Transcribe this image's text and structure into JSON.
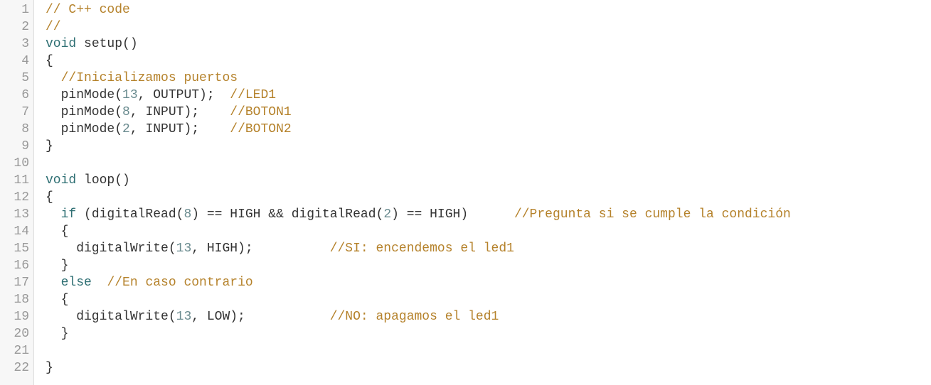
{
  "editor": {
    "colors": {
      "comment": "#b5822b",
      "keyword": "#2e6f73",
      "number": "#6a8b8f",
      "text": "#333333",
      "gutter_bg": "#f7f7f7",
      "line_number": "#999999"
    },
    "lines": [
      {
        "num": "1",
        "tokens": [
          {
            "t": "com",
            "v": "// C++ code"
          }
        ]
      },
      {
        "num": "2",
        "tokens": [
          {
            "t": "com",
            "v": "//"
          }
        ]
      },
      {
        "num": "3",
        "tokens": [
          {
            "t": "kw",
            "v": "void"
          },
          {
            "t": "txt",
            "v": " setup()"
          }
        ]
      },
      {
        "num": "4",
        "tokens": [
          {
            "t": "txt",
            "v": "{"
          }
        ]
      },
      {
        "num": "5",
        "tokens": [
          {
            "t": "txt",
            "v": "  "
          },
          {
            "t": "com",
            "v": "//Inicializamos puertos"
          }
        ]
      },
      {
        "num": "6",
        "tokens": [
          {
            "t": "txt",
            "v": "  pinMode("
          },
          {
            "t": "num",
            "v": "13"
          },
          {
            "t": "txt",
            "v": ", OUTPUT);  "
          },
          {
            "t": "com",
            "v": "//LED1"
          }
        ]
      },
      {
        "num": "7",
        "tokens": [
          {
            "t": "txt",
            "v": "  pinMode("
          },
          {
            "t": "num",
            "v": "8"
          },
          {
            "t": "txt",
            "v": ", INPUT);    "
          },
          {
            "t": "com",
            "v": "//BOTON1"
          }
        ]
      },
      {
        "num": "8",
        "tokens": [
          {
            "t": "txt",
            "v": "  pinMode("
          },
          {
            "t": "num",
            "v": "2"
          },
          {
            "t": "txt",
            "v": ", INPUT);    "
          },
          {
            "t": "com",
            "v": "//BOTON2"
          }
        ]
      },
      {
        "num": "9",
        "tokens": [
          {
            "t": "txt",
            "v": "}"
          }
        ]
      },
      {
        "num": "10",
        "tokens": [
          {
            "t": "txt",
            "v": ""
          }
        ]
      },
      {
        "num": "11",
        "tokens": [
          {
            "t": "kw",
            "v": "void"
          },
          {
            "t": "txt",
            "v": " loop()"
          }
        ]
      },
      {
        "num": "12",
        "tokens": [
          {
            "t": "txt",
            "v": "{"
          }
        ]
      },
      {
        "num": "13",
        "tokens": [
          {
            "t": "txt",
            "v": "  "
          },
          {
            "t": "kw",
            "v": "if"
          },
          {
            "t": "txt",
            "v": " (digitalRead("
          },
          {
            "t": "num",
            "v": "8"
          },
          {
            "t": "txt",
            "v": ") == HIGH && digitalRead("
          },
          {
            "t": "num",
            "v": "2"
          },
          {
            "t": "txt",
            "v": ") == HIGH)      "
          },
          {
            "t": "com",
            "v": "//Pregunta si se cumple la condición"
          }
        ]
      },
      {
        "num": "14",
        "tokens": [
          {
            "t": "txt",
            "v": "  {"
          }
        ]
      },
      {
        "num": "15",
        "tokens": [
          {
            "t": "txt",
            "v": "    digitalWrite("
          },
          {
            "t": "num",
            "v": "13"
          },
          {
            "t": "txt",
            "v": ", HIGH);          "
          },
          {
            "t": "com",
            "v": "//SI: encendemos el led1"
          }
        ]
      },
      {
        "num": "16",
        "tokens": [
          {
            "t": "txt",
            "v": "  }"
          }
        ]
      },
      {
        "num": "17",
        "tokens": [
          {
            "t": "txt",
            "v": "  "
          },
          {
            "t": "kw",
            "v": "else"
          },
          {
            "t": "txt",
            "v": "  "
          },
          {
            "t": "com",
            "v": "//En caso contrario"
          }
        ]
      },
      {
        "num": "18",
        "tokens": [
          {
            "t": "txt",
            "v": "  {"
          }
        ]
      },
      {
        "num": "19",
        "tokens": [
          {
            "t": "txt",
            "v": "    digitalWrite("
          },
          {
            "t": "num",
            "v": "13"
          },
          {
            "t": "txt",
            "v": ", LOW);           "
          },
          {
            "t": "com",
            "v": "//NO: apagamos el led1"
          }
        ]
      },
      {
        "num": "20",
        "tokens": [
          {
            "t": "txt",
            "v": "  }"
          }
        ]
      },
      {
        "num": "21",
        "tokens": [
          {
            "t": "txt",
            "v": ""
          }
        ]
      },
      {
        "num": "22",
        "tokens": [
          {
            "t": "txt",
            "v": "}"
          }
        ]
      }
    ]
  }
}
